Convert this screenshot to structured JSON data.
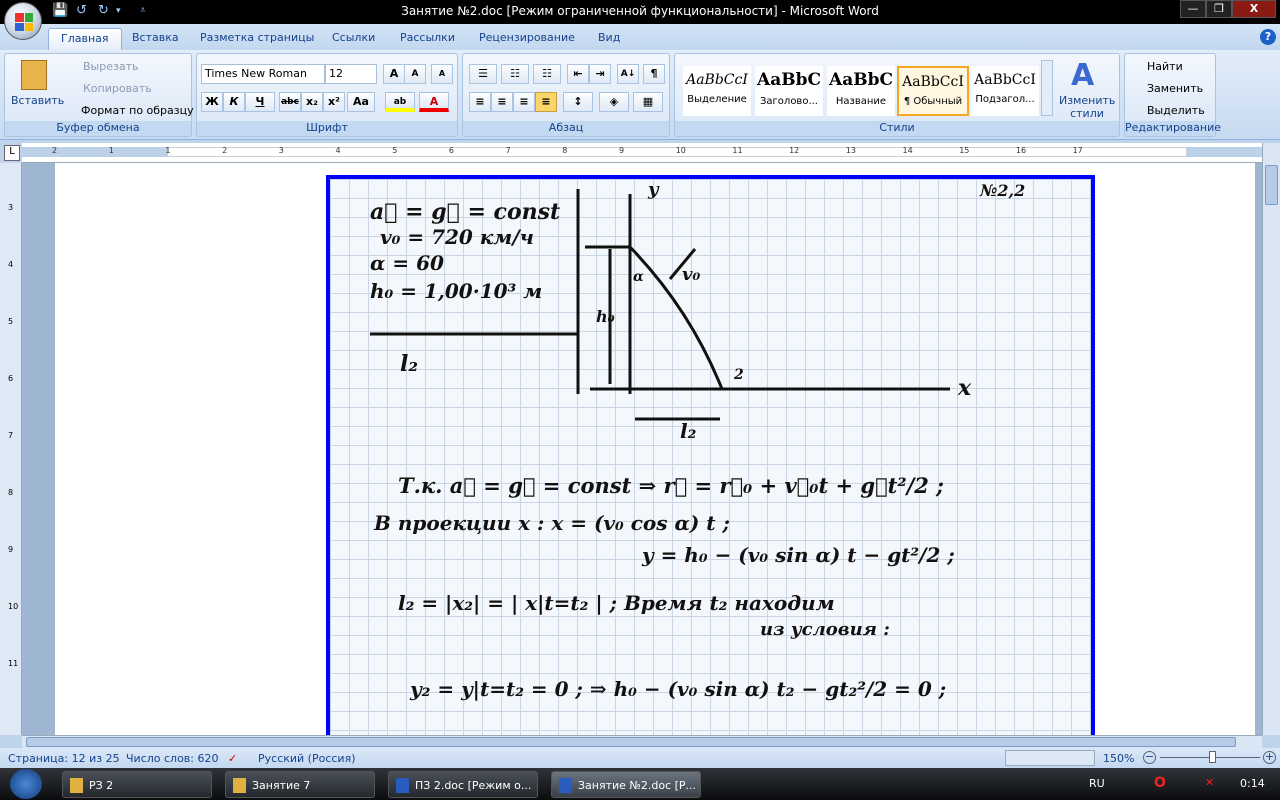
{
  "window": {
    "title": "Занятие №2.doc [Режим ограниченной функциональности] - Microsoft Word",
    "min": "—",
    "max": "❐",
    "close": "X"
  },
  "qat": {
    "save": "💾",
    "undo": "↺",
    "redo": "↻",
    "more": "▾",
    "customize": "⩡"
  },
  "tabs": [
    "Главная",
    "Вставка",
    "Разметка страницы",
    "Ссылки",
    "Рассылки",
    "Рецензирование",
    "Вид"
  ],
  "help": "?",
  "clipboard": {
    "paste": "Вставить",
    "cut": "Вырезать",
    "copy": "Копировать",
    "format_painter": "Формат по образцу",
    "label": "Буфер обмена"
  },
  "font": {
    "name": "Times New Roman",
    "size": "12",
    "grow": "A",
    "shrink": "A",
    "clear": "A",
    "bold": "Ж",
    "italic": "К",
    "underline": "Ч",
    "strike": "abc",
    "sub": "x₂",
    "sup": "x²",
    "case": "Aa",
    "highlight": "ab",
    "color": "A",
    "label": "Шрифт"
  },
  "paragraph": {
    "bullets": "☰",
    "numbering": "☷",
    "multilevel": "☷",
    "outdent": "⇤",
    "indent": "⇥",
    "sort": "А↓",
    "marks": "¶",
    "left": "≡",
    "center": "≡",
    "right": "≡",
    "justify": "≡",
    "spacing": "↕",
    "shading": "◈",
    "borders": "▦",
    "label": "Абзац"
  },
  "styles": {
    "items": [
      {
        "sample": "AaBbCcI",
        "name": "Выделение"
      },
      {
        "sample": "AaBbC",
        "name": "Заголово..."
      },
      {
        "sample": "AaBbC",
        "name": "Название"
      },
      {
        "sample": "AaBbCcI",
        "name": "¶ Обычный",
        "selected": true
      },
      {
        "sample": "AaBbCcI",
        "name": "Подзагол..."
      }
    ],
    "change": "Изменить стили",
    "label": "Стили"
  },
  "editing": {
    "find": "Найти",
    "replace": "Заменить",
    "select": "Выделить",
    "label": "Редактирование"
  },
  "ruler": {
    "marks": [
      "2",
      "1",
      "1",
      "2",
      "3",
      "4",
      "5",
      "6",
      "7",
      "8",
      "9",
      "10",
      "11",
      "12",
      "13",
      "14",
      "15",
      "16",
      "17"
    ]
  },
  "vruler": {
    "marks": [
      "3",
      "4",
      "5",
      "6",
      "7",
      "8",
      "9",
      "10",
      "11"
    ]
  },
  "document": {
    "image_text": {
      "problem": "№2,2",
      "given": [
        "a⃗ = g⃗ = const",
        "v₀ = 720 км/ч",
        "α = 60",
        "h₀ = 1,00·10³ м",
        "l₂"
      ],
      "diagram": [
        "y",
        "v₀",
        "h₀",
        "α",
        "2",
        "x",
        "l₂"
      ],
      "solution": [
        "Т.к. a⃗ = g⃗ = const ⇒ r⃗ = r⃗₀ + v⃗₀t + g⃗t²/2 ;",
        "В проекции x :   x = (v₀ cos α) t ;",
        "y = h₀ − (v₀ sin α) t − gt²/2 ;",
        "l₂ = |x₂| = | x|t=t₂ | ; Время t₂ находим",
        "из условия :",
        "y₂ = y|t=t₂ = 0 ; ⇒ h₀ − (v₀ sin α) t₂ − gt₂²/2 = 0 ;"
      ]
    }
  },
  "status": {
    "page": "Страница: 12 из 25",
    "words": "Число слов: 620",
    "language": "Русский (Россия)",
    "zoom": "150%",
    "zoom_percent": 150
  },
  "taskbar": {
    "items": [
      {
        "label": "РЗ 2"
      },
      {
        "label": "Занятие 7"
      },
      {
        "label": "ПЗ 2.doc [Режим о..."
      },
      {
        "label": "Занятие №2.doc [Р...",
        "active": true
      }
    ],
    "lang": "RU",
    "clock": "0:14"
  },
  "colors": {
    "accent": "#15428b",
    "image_border": "#0000ff",
    "selected_style": "#f5a623"
  }
}
